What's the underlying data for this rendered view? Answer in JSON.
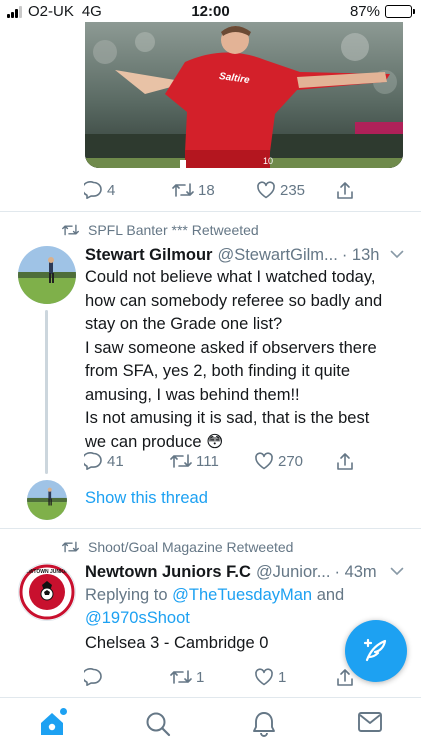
{
  "status_bar": {
    "carrier": "O2-UK",
    "network": "4G",
    "time": "12:00",
    "battery": "87%",
    "battery_level": 0.87
  },
  "tweets": [
    {
      "media": {
        "sponsor_text": "Saltire"
      },
      "actions": {
        "replies": "4",
        "retweets": "18",
        "likes": "235"
      }
    },
    {
      "retweeted_by": "SPFL Banter *** Retweeted",
      "name": "Stewart Gilmour",
      "handle": "@StewartGilm...",
      "time": "· 13h",
      "text_lines": [
        "Could not believe what I watched today,",
        "how can somebody referee so badly and",
        "stay on the Grade one list?",
        "I saw someone asked if observers there",
        "from SFA, yes 2, both finding it quite",
        "amusing, I was behind them!!",
        "Is not amusing it is sad, that is the best",
        "we can produce 😳"
      ],
      "actions": {
        "replies": "41",
        "retweets": "111",
        "likes": "270"
      },
      "show_thread": "Show this thread"
    },
    {
      "retweeted_by": "Shoot/Goal Magazine Retweeted",
      "name": "Newtown Juniors F.C",
      "handle": "@Junior...",
      "time": "· 43m",
      "replying_prefix": "Replying to",
      "replying_to_1": "@TheTuesdayMan",
      "replying_and": "and",
      "replying_to_2": "@1970sShoot",
      "text": "Chelsea 3 - Cambridge 0",
      "avatar_text": "NEWTOWN JUNIORS",
      "actions": {
        "replies": "",
        "retweets": "1",
        "likes": "1"
      }
    }
  ],
  "tab_bar": {
    "items": [
      "home-icon",
      "search-icon",
      "notifications-icon",
      "messages-icon"
    ],
    "active": "home"
  },
  "colors": {
    "accent": "#1da1f2",
    "secondary_text": "#657786",
    "primary_text": "#14171a",
    "divider": "#e1e8ed"
  }
}
